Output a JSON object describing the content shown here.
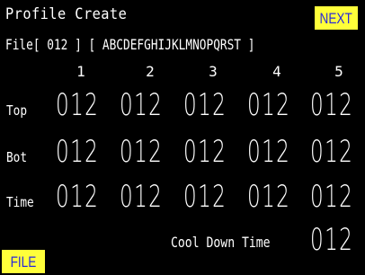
{
  "screen_title": "Profile Create",
  "next_label": "NEXT",
  "file_button_label": "FILE",
  "file_line": "File[ 012 ] [ ABCDEFGHIJKLMNOPQRST ]",
  "columns": [
    "1",
    "2",
    "3",
    "4",
    "5"
  ],
  "rows": [
    {
      "label": "Top",
      "values": [
        "012",
        "012",
        "012",
        "012",
        "012"
      ]
    },
    {
      "label": "Bot",
      "values": [
        "012",
        "012",
        "012",
        "012",
        "012"
      ]
    },
    {
      "label": "Time",
      "values": [
        "012",
        "012",
        "012",
        "012",
        "012"
      ]
    }
  ],
  "cool_down": {
    "label": "Cool Down Time",
    "value": "012"
  },
  "colors": {
    "background": "#000000",
    "button_bg": "#ffff3a",
    "button_text": "#2a2ad8",
    "text": "#ffffff"
  }
}
